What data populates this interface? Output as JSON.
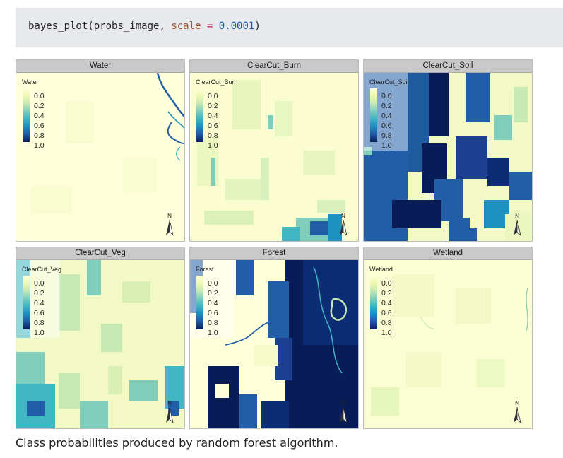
{
  "code": {
    "fn": "bayes_plot",
    "open_paren": "(",
    "arg1": "probs_image",
    "comma": ", ",
    "param": "scale",
    "equals": " = ",
    "value": "0.0001",
    "close_paren": ")"
  },
  "panels": [
    {
      "title": "Water",
      "legend_title": "Water",
      "north": "N"
    },
    {
      "title": "ClearCut_Burn",
      "legend_title": "ClearCut_Burn",
      "north": "N"
    },
    {
      "title": "ClearCut_Soil",
      "legend_title": "ClearCut_Soil",
      "north": "N"
    },
    {
      "title": "ClearCut_Veg",
      "legend_title": "ClearCut_Veg",
      "north": "N"
    },
    {
      "title": "Forest",
      "legend_title": "Forest",
      "north": "N"
    },
    {
      "title": "Wetland",
      "legend_title": "Wetland",
      "north": "N"
    }
  ],
  "legend_labels": [
    "0.0",
    "0.2",
    "0.4",
    "0.6",
    "0.8",
    "1.0"
  ],
  "colors": {
    "low": "#ffffd9",
    "mid": "#41b6c4",
    "high": "#081d58",
    "code_background": "#e8e9ec",
    "strip": "#c9c9c9"
  },
  "caption": "Class probabilities produced by random forest algorithm."
}
